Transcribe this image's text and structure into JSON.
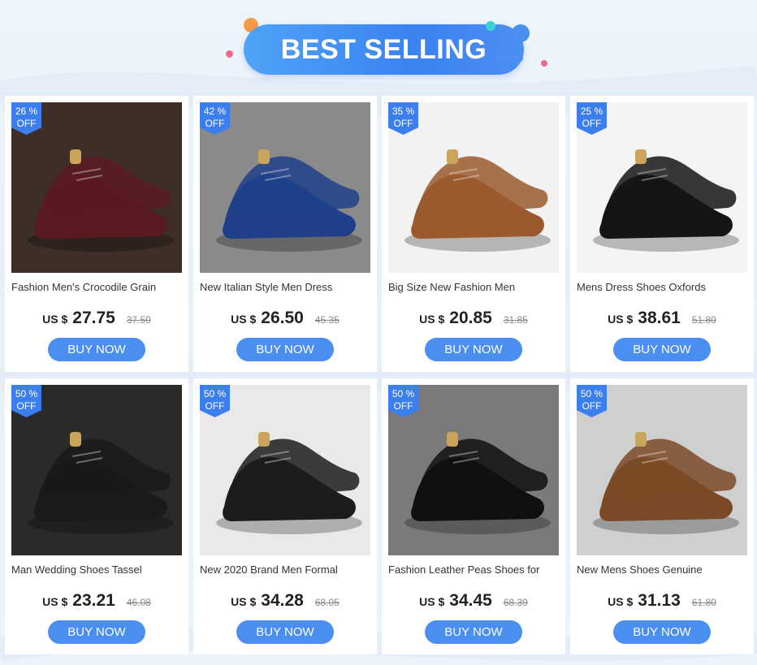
{
  "header": {
    "title": "BEST SELLING"
  },
  "products": [
    {
      "discount_pct": "26 %",
      "discount_off": "OFF",
      "name": "Fashion Men's Crocodile Grain",
      "currency": "US $",
      "price": "27.75",
      "old_price": "37.50",
      "button": "BUY NOW",
      "colors": {
        "bg": "#3e2e28",
        "shoe": "#5a1a22"
      }
    },
    {
      "discount_pct": "42 %",
      "discount_off": "OFF",
      "name": "New Italian Style Men Dress",
      "currency": "US $",
      "price": "26.50",
      "old_price": "45.35",
      "button": "BUY NOW",
      "colors": {
        "bg": "#8a8a8a",
        "shoe": "#1f3f8a"
      }
    },
    {
      "discount_pct": "35 %",
      "discount_off": "OFF",
      "name": "Big Size New Fashion Men",
      "currency": "US $",
      "price": "20.85",
      "old_price": "31.85",
      "button": "BUY NOW",
      "colors": {
        "bg": "#f2f2f2",
        "shoe": "#9a5a2e"
      }
    },
    {
      "discount_pct": "25 %",
      "discount_off": "OFF",
      "name": "Mens Dress Shoes Oxfords",
      "currency": "US $",
      "price": "38.61",
      "old_price": "51.80",
      "button": "BUY NOW",
      "colors": {
        "bg": "#f4f4f4",
        "shoe": "#151515"
      }
    },
    {
      "discount_pct": "50 %",
      "discount_off": "OFF",
      "name": "Man Wedding Shoes Tassel",
      "currency": "US $",
      "price": "23.21",
      "old_price": "46.08",
      "button": "BUY NOW",
      "colors": {
        "bg": "#2a2a2a",
        "shoe": "#1a1a1a"
      }
    },
    {
      "discount_pct": "50 %",
      "discount_off": "OFF",
      "name": "New 2020 Brand Men Formal",
      "currency": "US $",
      "price": "34.28",
      "old_price": "68.05",
      "button": "BUY NOW",
      "colors": {
        "bg": "#e9e9e9",
        "shoe": "#1c1c1c"
      }
    },
    {
      "discount_pct": "50 %",
      "discount_off": "OFF",
      "name": "Fashion Leather Peas Shoes for",
      "currency": "US $",
      "price": "34.45",
      "old_price": "68.39",
      "button": "BUY NOW",
      "colors": {
        "bg": "#7a7a7a",
        "shoe": "#101010"
      }
    },
    {
      "discount_pct": "50 %",
      "discount_off": "OFF",
      "name": "New Mens Shoes Genuine",
      "currency": "US $",
      "price": "31.13",
      "old_price": "61.80",
      "button": "BUY NOW",
      "colors": {
        "bg": "#cfcfcf",
        "shoe": "#7a4a26"
      }
    }
  ],
  "accent": "#3b7fef"
}
